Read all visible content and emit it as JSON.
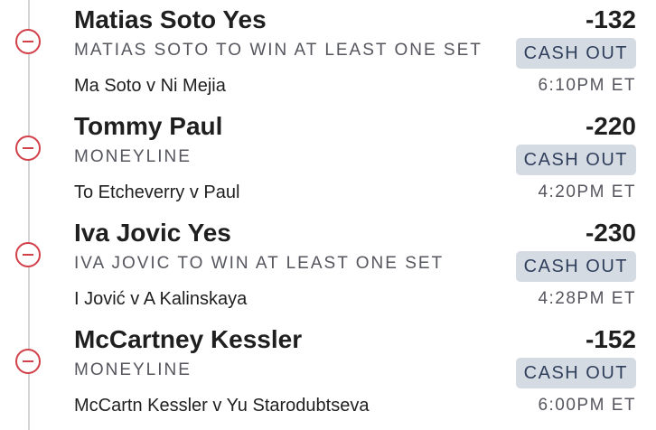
{
  "legs": [
    {
      "selection": "Matias Soto Yes",
      "odds": "-132",
      "market": "MATIAS SOTO TO WIN AT LEAST ONE SET",
      "cash_out": "CASH OUT",
      "matchup": "Ma Soto v Ni Mejia",
      "time": "6:10PM ET"
    },
    {
      "selection": "Tommy Paul",
      "odds": "-220",
      "market": "MONEYLINE",
      "cash_out": "CASH OUT",
      "matchup": "To Etcheverry v Paul",
      "time": "4:20PM ET"
    },
    {
      "selection": "Iva Jovic Yes",
      "odds": "-230",
      "market": "IVA JOVIC TO WIN AT LEAST ONE SET",
      "cash_out": "CASH OUT",
      "matchup": "I Jović v A Kalinskaya",
      "time": "4:28PM ET"
    },
    {
      "selection": "McCartney Kessler",
      "odds": "-152",
      "market": "MONEYLINE",
      "cash_out": "CASH OUT",
      "matchup": "McCartn Kessler v Yu Starodubtseva",
      "time": "6:00PM ET"
    }
  ],
  "icons": {
    "remove": "minus-circle-icon"
  },
  "colors": {
    "remove_red": "#d2404a",
    "cash_out_bg": "#d5dbe3",
    "cash_out_text": "#2f3f5c",
    "timeline": "#d4d4d8"
  }
}
